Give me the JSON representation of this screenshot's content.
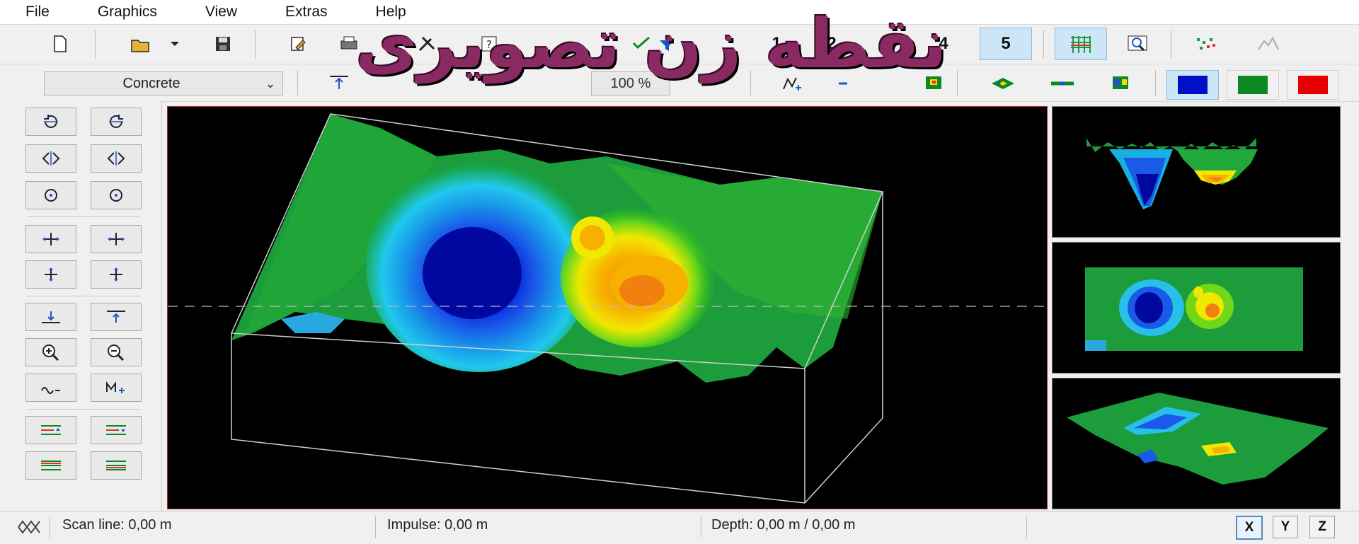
{
  "menu": [
    "File",
    "Graphics",
    "View",
    "Extras",
    "Help"
  ],
  "toolbar1": {
    "icons": [
      "new-icon",
      "open-icon",
      "dropdown-icon",
      "save-icon",
      "edit-icon",
      "print-icon",
      "tools-icon",
      "help-icon",
      "marker-icon",
      "filter-icon"
    ],
    "view_numbers": [
      "1",
      "2",
      "3",
      "4",
      "5"
    ],
    "active_view": "5"
  },
  "toolbar2": {
    "material_select": "Concrete",
    "zoom_value": "100 %",
    "colors": [
      "#0010c8",
      "#0a8a20",
      "#e80000"
    ]
  },
  "overlay_text": "نقطه زن تصویری",
  "status": {
    "scan_line": "Scan line: 0,00 m",
    "impulse": "Impulse: 0,00 m",
    "depth": "Depth: 0,00 m / 0,00 m"
  },
  "axes": [
    "X",
    "Y",
    "Z"
  ],
  "active_axis": "X"
}
